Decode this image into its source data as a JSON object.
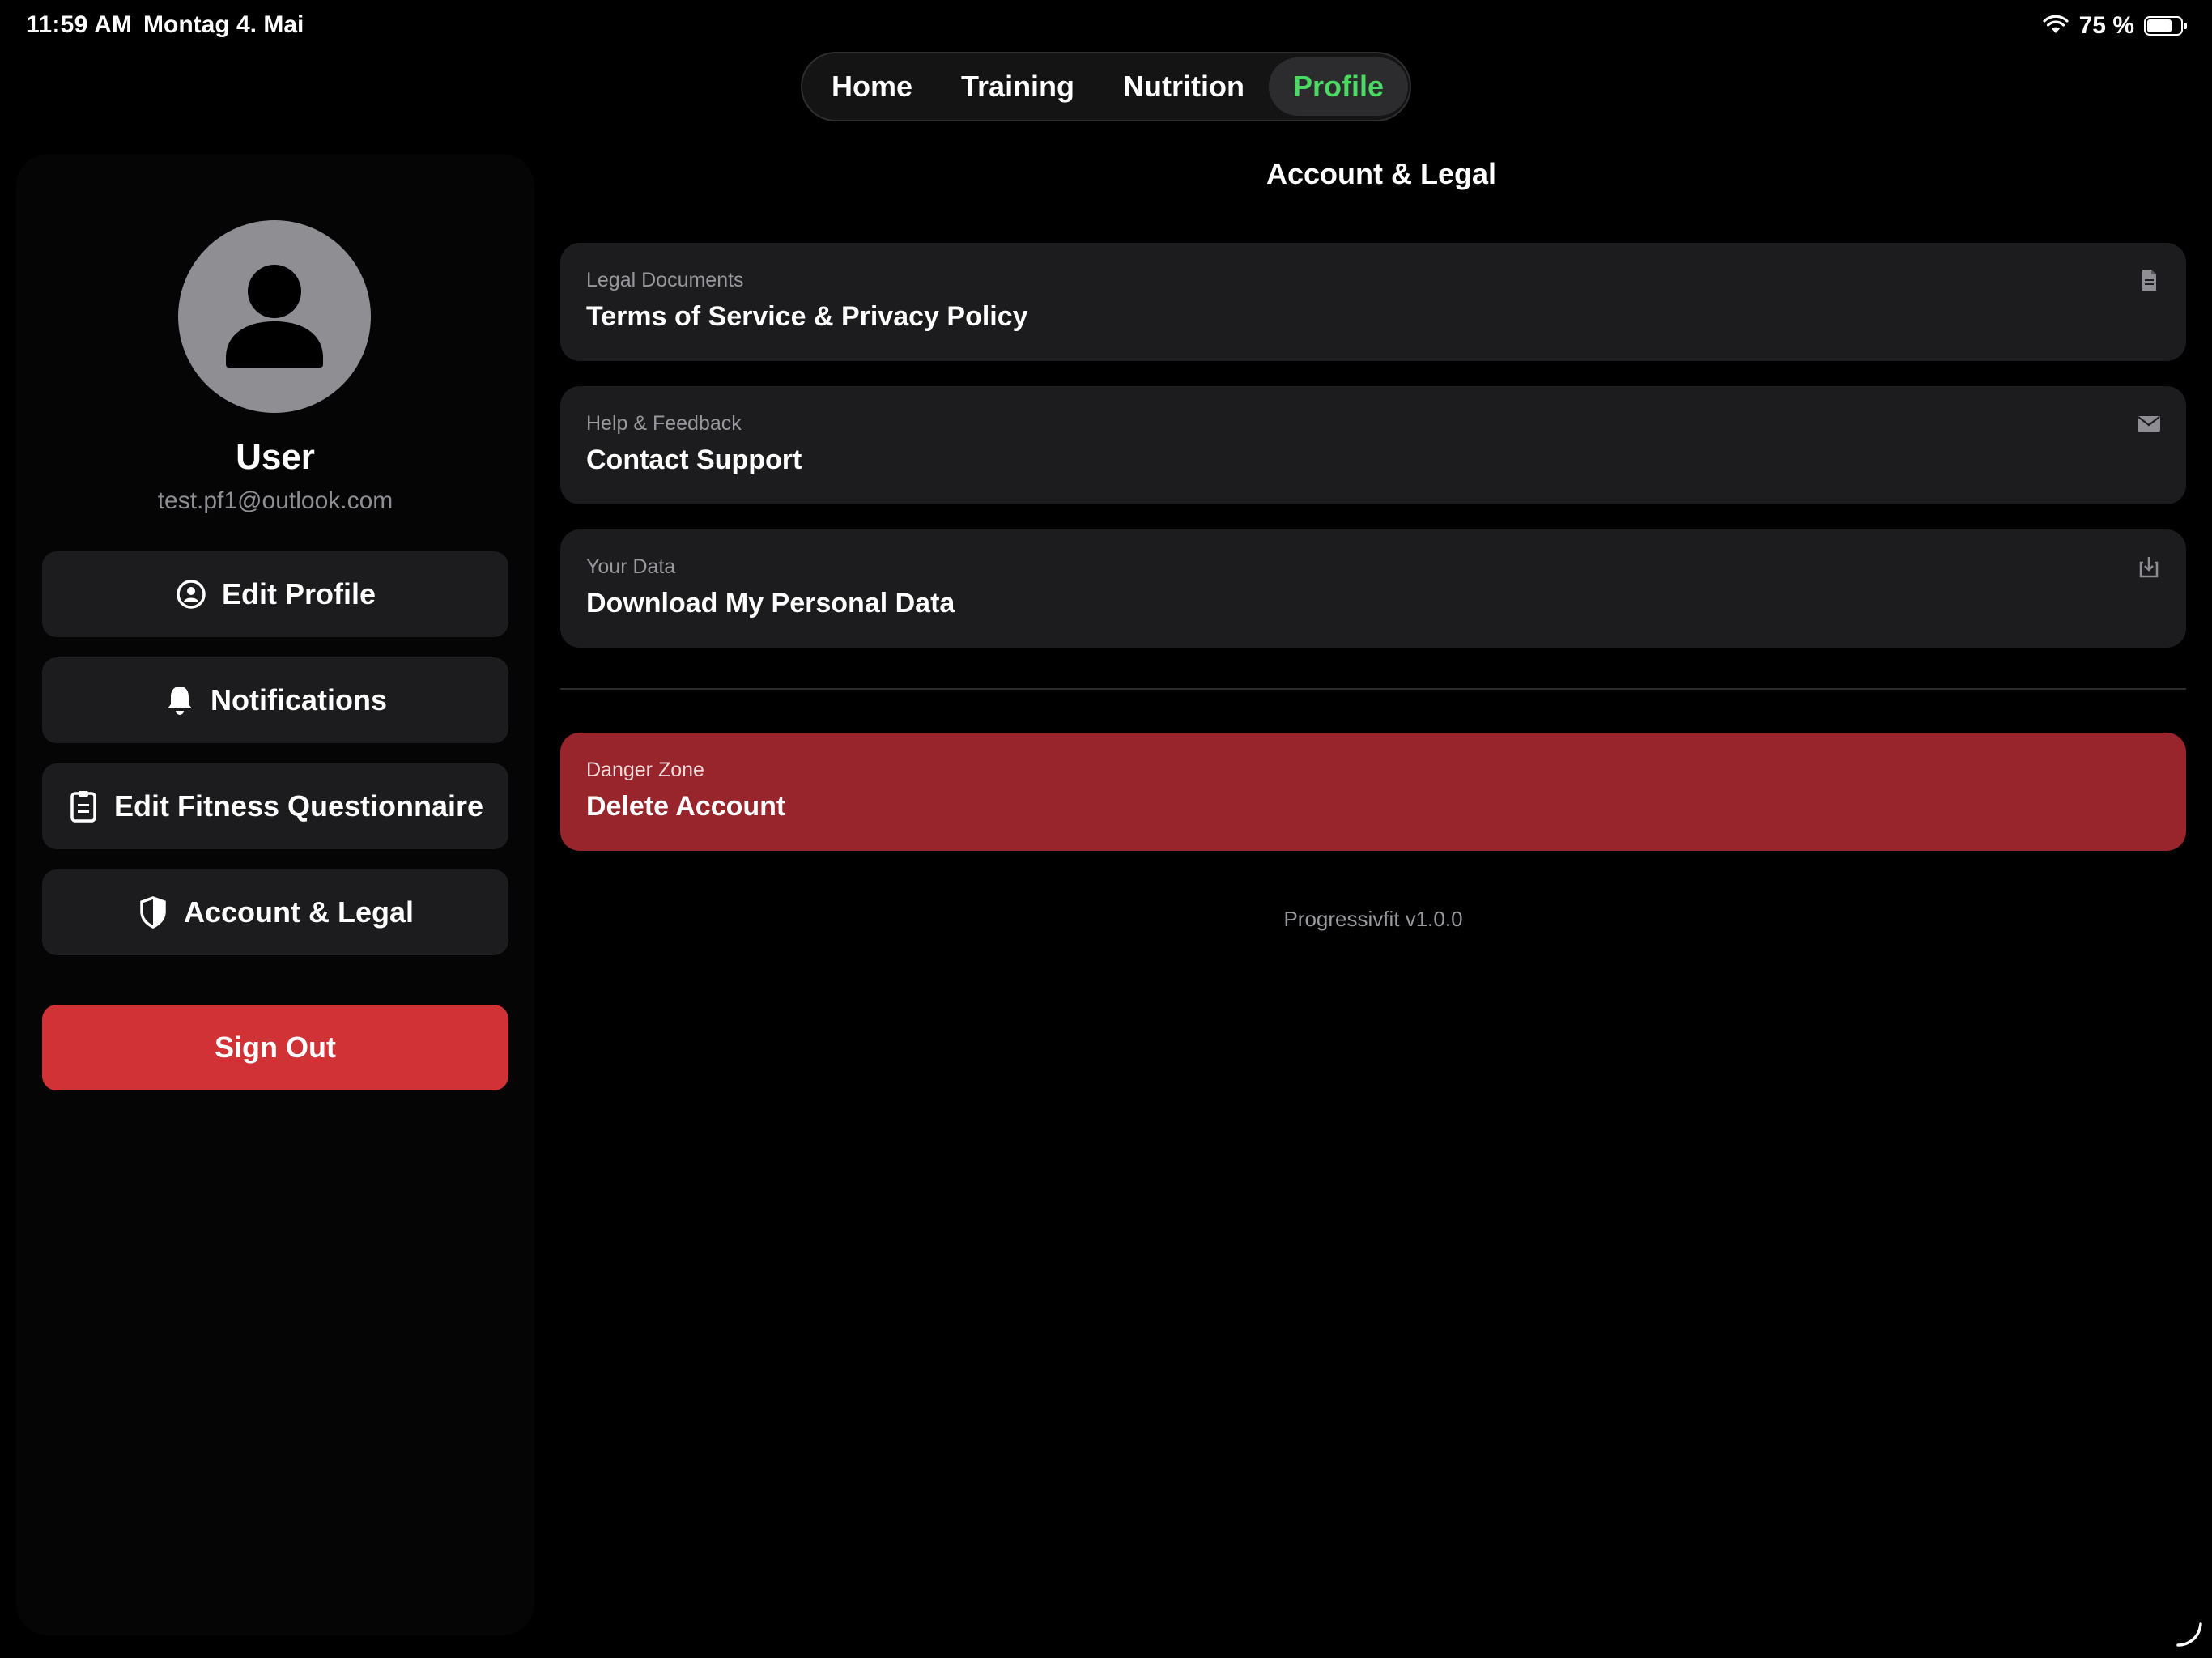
{
  "status_bar": {
    "time": "11:59 AM",
    "date": "Montag 4. Mai",
    "battery_percent": "75 %",
    "battery_level": 0.75,
    "icons": [
      "wifi-icon",
      "battery-icon"
    ]
  },
  "tabs": [
    {
      "label": "Home",
      "active": false
    },
    {
      "label": "Training",
      "active": false
    },
    {
      "label": "Nutrition",
      "active": false
    },
    {
      "label": "Profile",
      "active": true
    }
  ],
  "sidebar": {
    "user_name": "User",
    "user_email": "test.pf1@outlook.com",
    "buttons": [
      {
        "label": "Edit Profile",
        "icon": "person-circle-icon"
      },
      {
        "label": "Notifications",
        "icon": "bell-icon"
      },
      {
        "label": "Edit Fitness Questionnaire",
        "icon": "clipboard-icon"
      },
      {
        "label": "Account & Legal",
        "icon": "shield-icon"
      }
    ],
    "sign_out_label": "Sign Out"
  },
  "main": {
    "title": "Account & Legal",
    "cards": [
      {
        "kicker": "Legal Documents",
        "label": "Terms of Service & Privacy Policy",
        "icon": "document-icon"
      },
      {
        "kicker": "Help & Feedback",
        "label": "Contact Support",
        "icon": "envelope-icon"
      },
      {
        "kicker": "Your Data",
        "label": "Download My Personal Data",
        "icon": "download-icon"
      }
    ],
    "danger": {
      "kicker": "Danger Zone",
      "label": "Delete Account"
    },
    "version": "Progressivfit v1.0.0"
  },
  "colors": {
    "background": "#000000",
    "card": "#1c1c1e",
    "active_tab_text": "#4cd964",
    "sign_out": "#d03236",
    "danger_card": "#97252b",
    "muted_text": "#98989d"
  }
}
